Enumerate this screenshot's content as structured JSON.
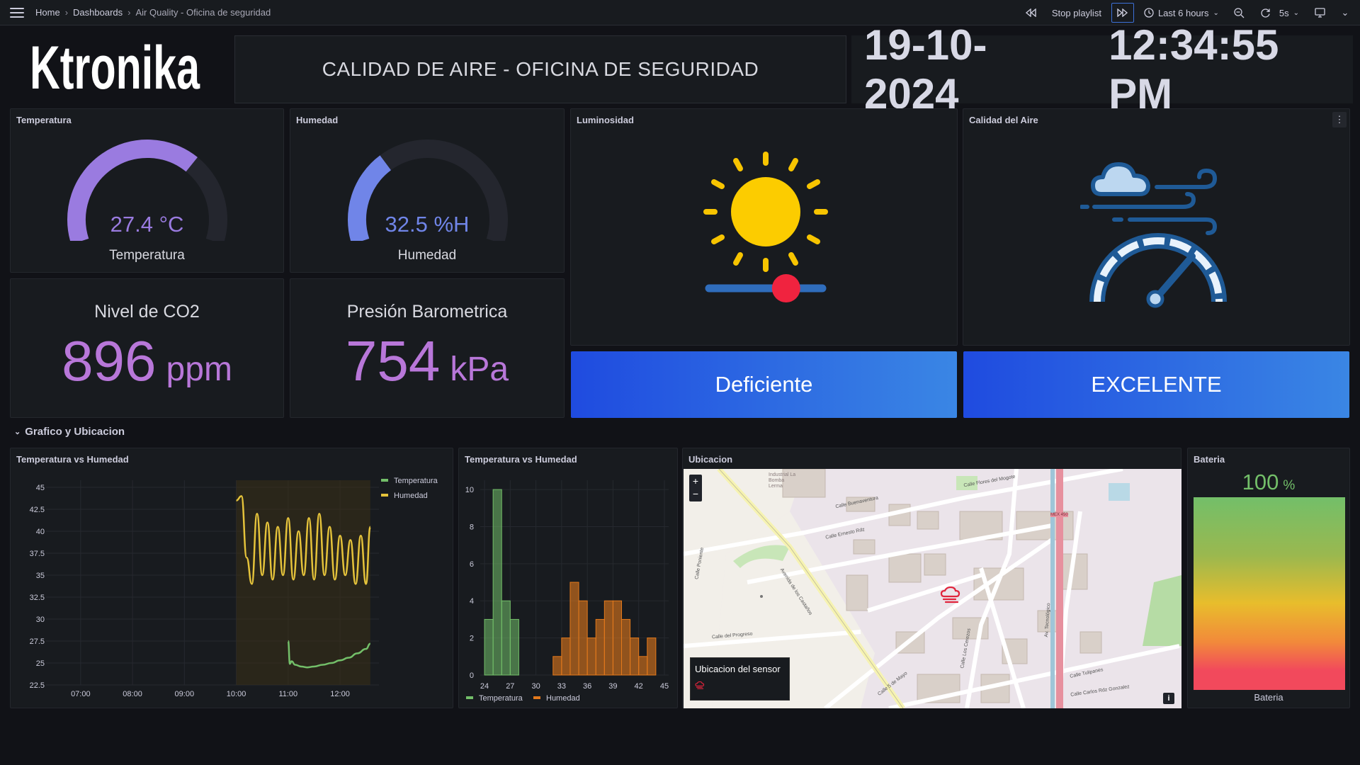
{
  "topbar": {
    "breadcrumbs": [
      "Home",
      "Dashboards",
      "Air Quality - Oficina de seguridad"
    ],
    "stop_playlist": "Stop playlist",
    "time_range": "Last 6 hours",
    "refresh_interval": "5s"
  },
  "header": {
    "logo_text": "Ktronika",
    "title": "CALIDAD DE AIRE - OFICINA DE SEGURIDAD",
    "date": "19-10-2024",
    "time": "12:34:55 PM"
  },
  "panels": {
    "temperatura": {
      "title": "Temperatura",
      "value": "27.4 °C",
      "label": "Temperatura",
      "fraction": 0.68,
      "color": "#9a7be0"
    },
    "humedad": {
      "title": "Humedad",
      "value": "32.5 %H",
      "label": "Humedad",
      "fraction": 0.33,
      "color": "#7085e8"
    },
    "co2": {
      "title": "Nivel de CO2",
      "value": "896",
      "unit": "ppm",
      "color": "#b877d9"
    },
    "presion": {
      "title": "Presión Barometrica",
      "value": "754",
      "unit": "kPa",
      "color": "#b877d9"
    },
    "luminosidad": {
      "title": "Luminosidad",
      "status": "Deficiente",
      "slider_level": 0.68
    },
    "calidad_aire": {
      "title": "Calidad del Aire",
      "status": "EXCELENTE"
    }
  },
  "row": {
    "title": "Grafico y Ubicacion"
  },
  "line_panel": {
    "title": "Temperatura vs Humedad"
  },
  "hist_panel": {
    "title": "Temperatura vs Humedad"
  },
  "map_panel": {
    "title": "Ubicacion",
    "tooltip": "Ubicacion del sensor",
    "zoom_in": "+",
    "zoom_out": "−",
    "info": "i",
    "street_labels": [
      "Industrial La Bomba Lerma",
      "Calle Buenaventura",
      "Calle Flores del Mogote",
      "Calle Ernesto Rdz",
      "Calle del Progreso",
      "Calle Poniente",
      "Avenida de los Castaños",
      "Calle 5 de Mayo",
      "Av. Tecnológico",
      "Calle Los Cerezos",
      "Calle Tulipanes",
      "Calle Carlos Rdz Gonzalez",
      "MEX 450"
    ]
  },
  "battery_panel": {
    "title": "Bateria",
    "value": "100",
    "unit": "%",
    "label": "Bateria",
    "fraction": 1.0
  },
  "chart_data": [
    {
      "type": "line",
      "title": "Temperatura vs Humedad",
      "x_ticks": [
        "07:00",
        "08:00",
        "09:00",
        "10:00",
        "11:00",
        "12:00"
      ],
      "y_ticks": [
        "45",
        "42.5",
        "40",
        "37.5",
        "35",
        "32.5",
        "30",
        "27.5",
        "25",
        "22.5"
      ],
      "ylim": [
        22.5,
        45
      ],
      "legend": "top-right",
      "series": [
        {
          "name": "Temperatura",
          "color": "#73bf69",
          "x": [
            "11:00",
            "11:02",
            "11:04",
            "11:08",
            "11:15",
            "11:22",
            "11:30",
            "11:40",
            "11:50",
            "12:00",
            "12:10",
            "12:20",
            "12:30",
            "12:35"
          ],
          "values": [
            27.5,
            24.9,
            25.2,
            24.8,
            24.6,
            24.5,
            24.6,
            24.8,
            25.0,
            25.3,
            25.6,
            26.1,
            26.6,
            27.2
          ]
        },
        {
          "name": "Humedad",
          "color": "#e5c33b",
          "x": [
            "10:00",
            "10:06",
            "10:12",
            "10:18",
            "10:24",
            "10:30",
            "10:36",
            "10:42",
            "10:48",
            "10:54",
            "11:00",
            "11:06",
            "11:12",
            "11:18",
            "11:24",
            "11:30",
            "11:36",
            "11:42",
            "11:48",
            "11:54",
            "12:00",
            "12:06",
            "12:12",
            "12:18",
            "12:24",
            "12:30",
            "12:35"
          ],
          "values": [
            43.5,
            44,
            37,
            34,
            42,
            35,
            41,
            34.5,
            40.5,
            35,
            41.5,
            34.5,
            40,
            35,
            41.5,
            34.5,
            42,
            35,
            40.5,
            34.5,
            39.5,
            35,
            39,
            34,
            39.5,
            34,
            40.5
          ]
        }
      ]
    },
    {
      "type": "bar",
      "title": "Temperatura vs Humedad",
      "x_ticks": [
        "24",
        "27",
        "30",
        "33",
        "36",
        "39",
        "42",
        "45"
      ],
      "y_ticks": [
        "0",
        "2",
        "4",
        "6",
        "8",
        "10"
      ],
      "ylim": [
        0,
        10.5
      ],
      "legend": "bottom-left",
      "series": [
        {
          "name": "Temperatura",
          "color": "#73bf69",
          "bins": [
            [
              24,
              25,
              3
            ],
            [
              25,
              26,
              10
            ],
            [
              26,
              27,
              4
            ],
            [
              27,
              28,
              3
            ]
          ]
        },
        {
          "name": "Humedad",
          "color": "#e3791c",
          "bins": [
            [
              32,
              33,
              1
            ],
            [
              33,
              34,
              2
            ],
            [
              34,
              35,
              5
            ],
            [
              35,
              36,
              4
            ],
            [
              36,
              37,
              2
            ],
            [
              37,
              38,
              3
            ],
            [
              38,
              39,
              4
            ],
            [
              39,
              40,
              4
            ],
            [
              40,
              41,
              3
            ],
            [
              41,
              42,
              2
            ],
            [
              42,
              43,
              1
            ],
            [
              43,
              44,
              2
            ]
          ]
        }
      ]
    }
  ]
}
